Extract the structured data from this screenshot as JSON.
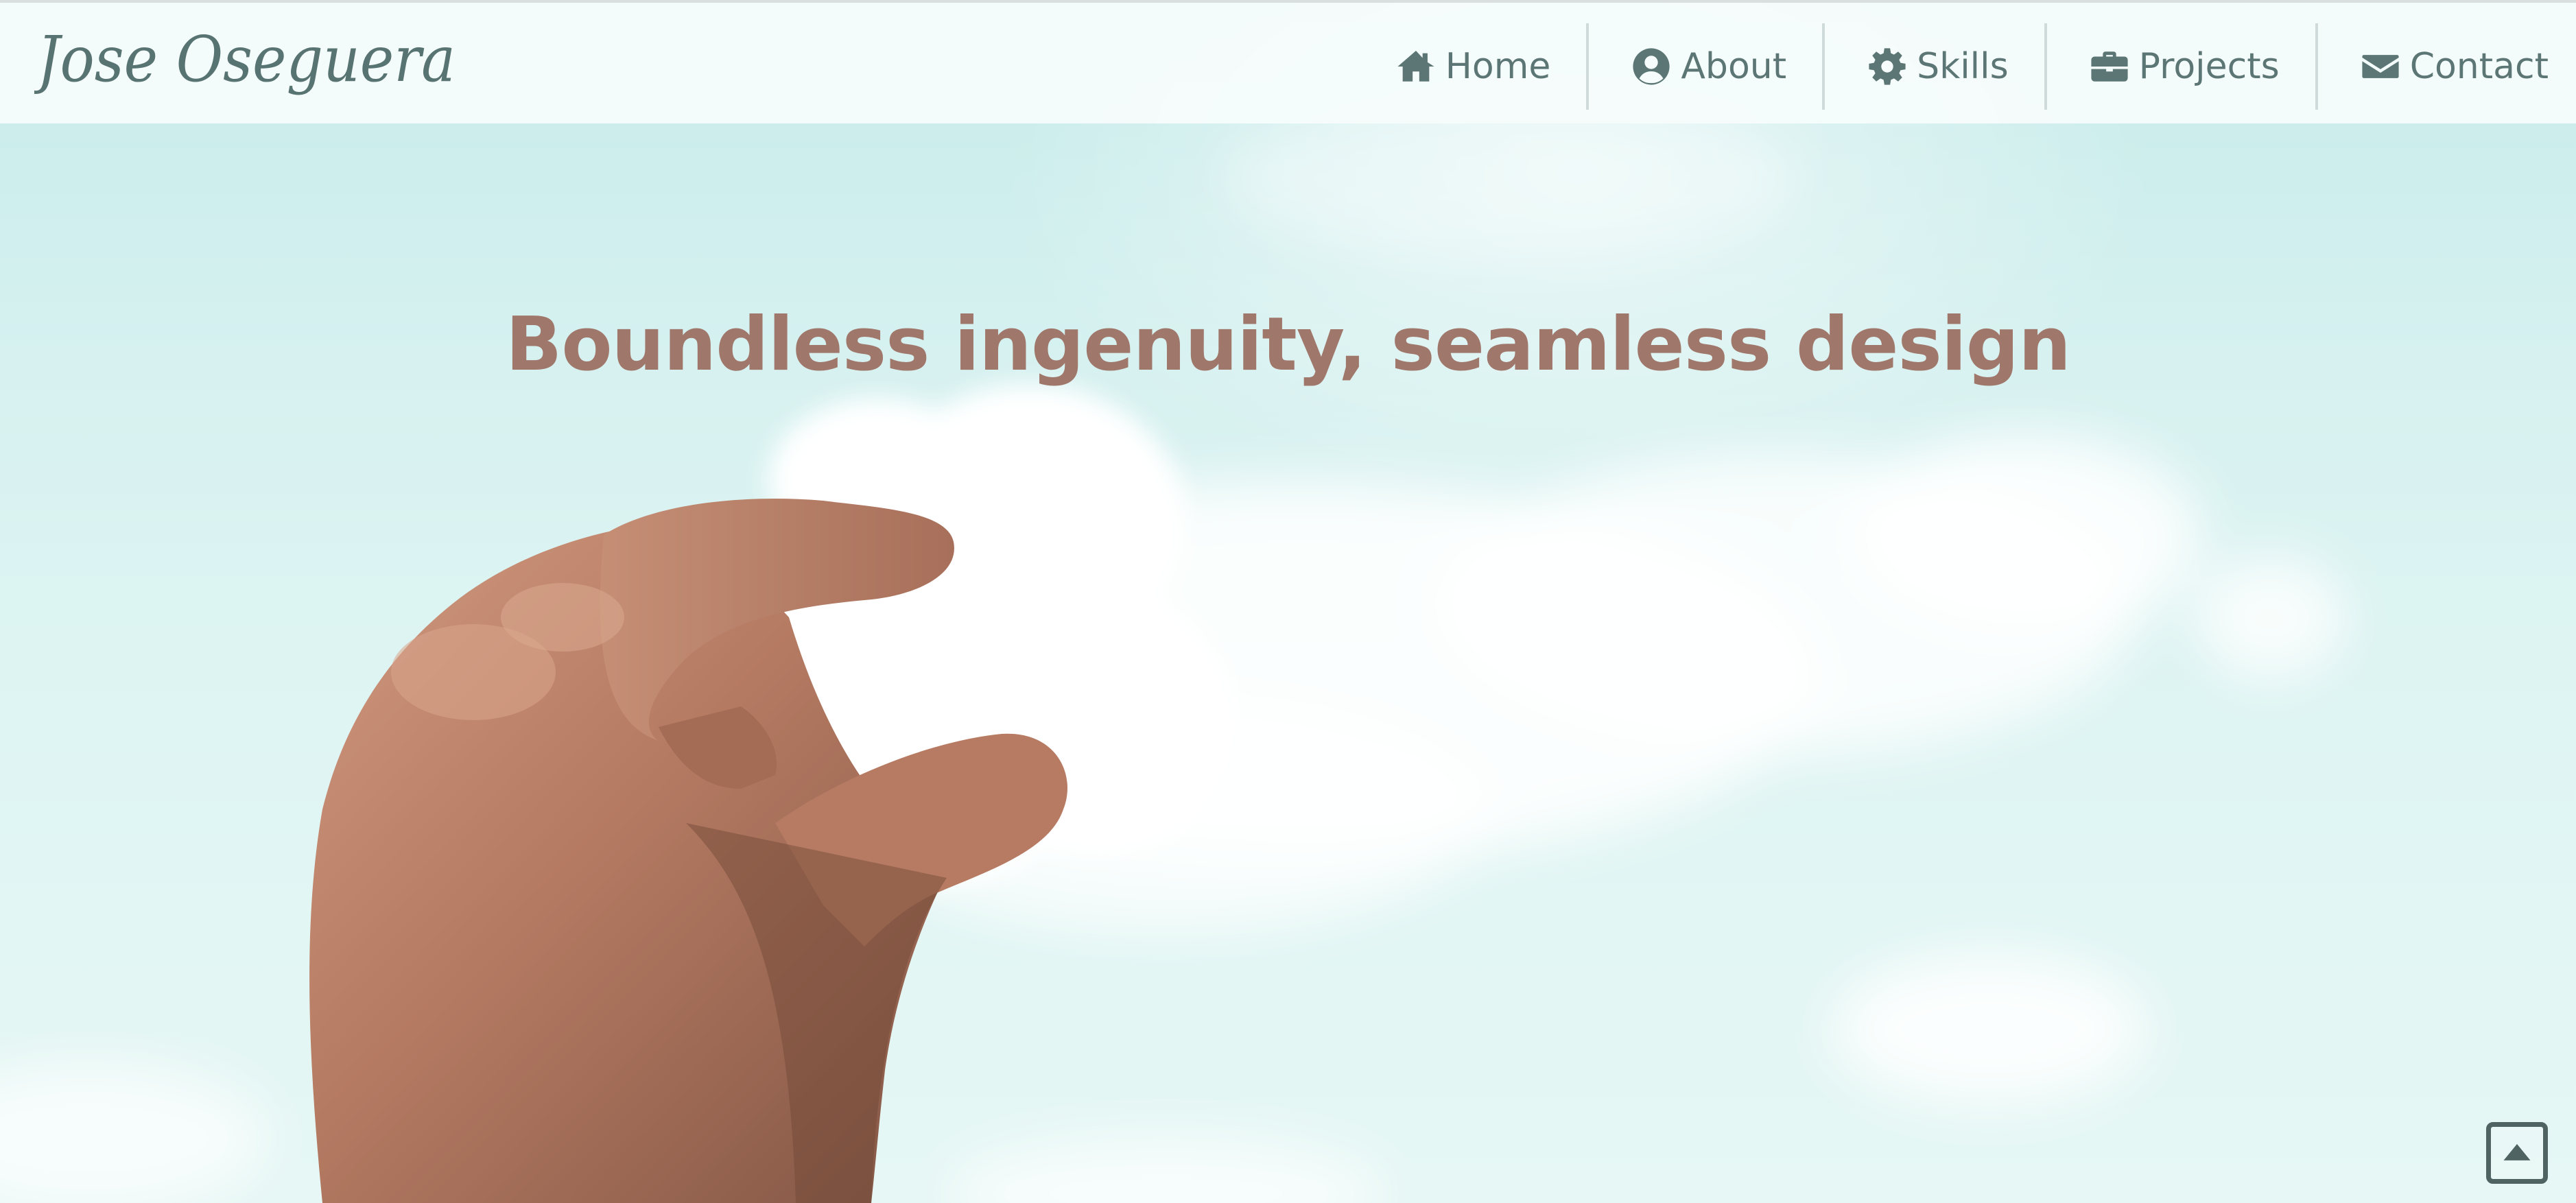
{
  "site": {
    "logo_text": "Jose Oseguera"
  },
  "nav": {
    "items": [
      {
        "label": "Home",
        "icon": "home-icon"
      },
      {
        "label": "About",
        "icon": "user-circle-icon"
      },
      {
        "label": "Skills",
        "icon": "gear-icon"
      },
      {
        "label": "Projects",
        "icon": "briefcase-icon"
      },
      {
        "label": "Contact",
        "icon": "envelope-icon"
      }
    ]
  },
  "hero": {
    "headline": "Boundless ingenuity, seamless design",
    "background_image": "hand-holding-cloud-photo"
  },
  "scroll_top": {
    "icon": "caret-up-square-icon"
  },
  "colors": {
    "headline": "#a0776b",
    "nav_text": "#5b7674",
    "logo": "#587472",
    "sky": "#cfeeee",
    "topbar_bg": "#f6fcfc"
  }
}
